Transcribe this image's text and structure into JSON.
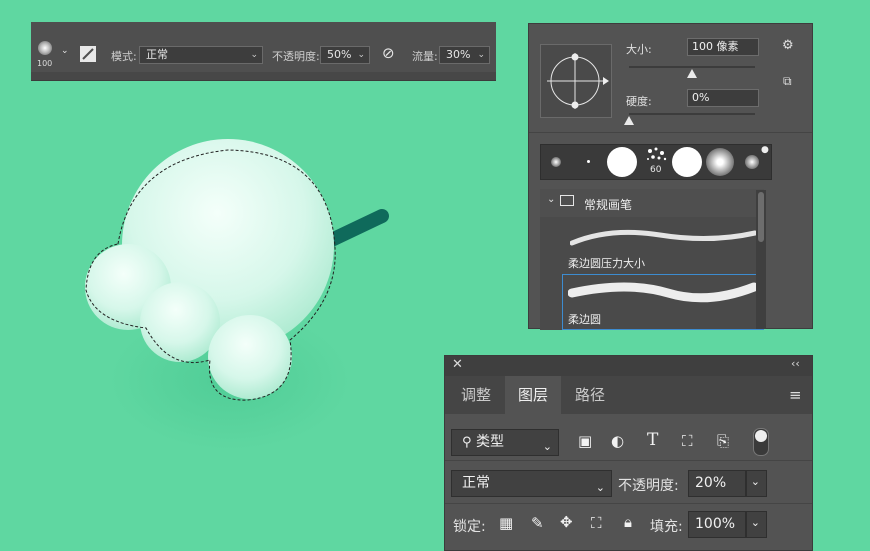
{
  "options_bar": {
    "brush_size": "100",
    "mode_label": "模式:",
    "mode_value": "正常",
    "opacity_label": "不透明度:",
    "opacity_value": "50%",
    "flow_label": "流量:",
    "flow_value": "30%"
  },
  "brush_settings": {
    "size_label": "大小:",
    "size_value": "100 像素",
    "hardness_label": "硬度:",
    "hardness_value": "0%",
    "size_slider_fraction": 0.48,
    "hardness_slider_fraction": 0.0,
    "tip_size_label": "60",
    "group_name": "常规画笔",
    "presets": [
      {
        "name": "柔边圆压力大小"
      },
      {
        "name": "柔边圆"
      }
    ]
  },
  "layers_panel": {
    "tabs": [
      {
        "label": "调整"
      },
      {
        "label": "图层"
      },
      {
        "label": "路径"
      }
    ],
    "active_tab": "图层",
    "filter_value": "类型",
    "blend_mode": "正常",
    "opacity_label": "不透明度:",
    "opacity_value": "20%",
    "lock_label": "锁定:",
    "fill_label": "填充:",
    "fill_value": "100%"
  },
  "colors": {
    "background": "#5fd7a1",
    "panel": "#535353",
    "stick": "#0f6a5b"
  }
}
